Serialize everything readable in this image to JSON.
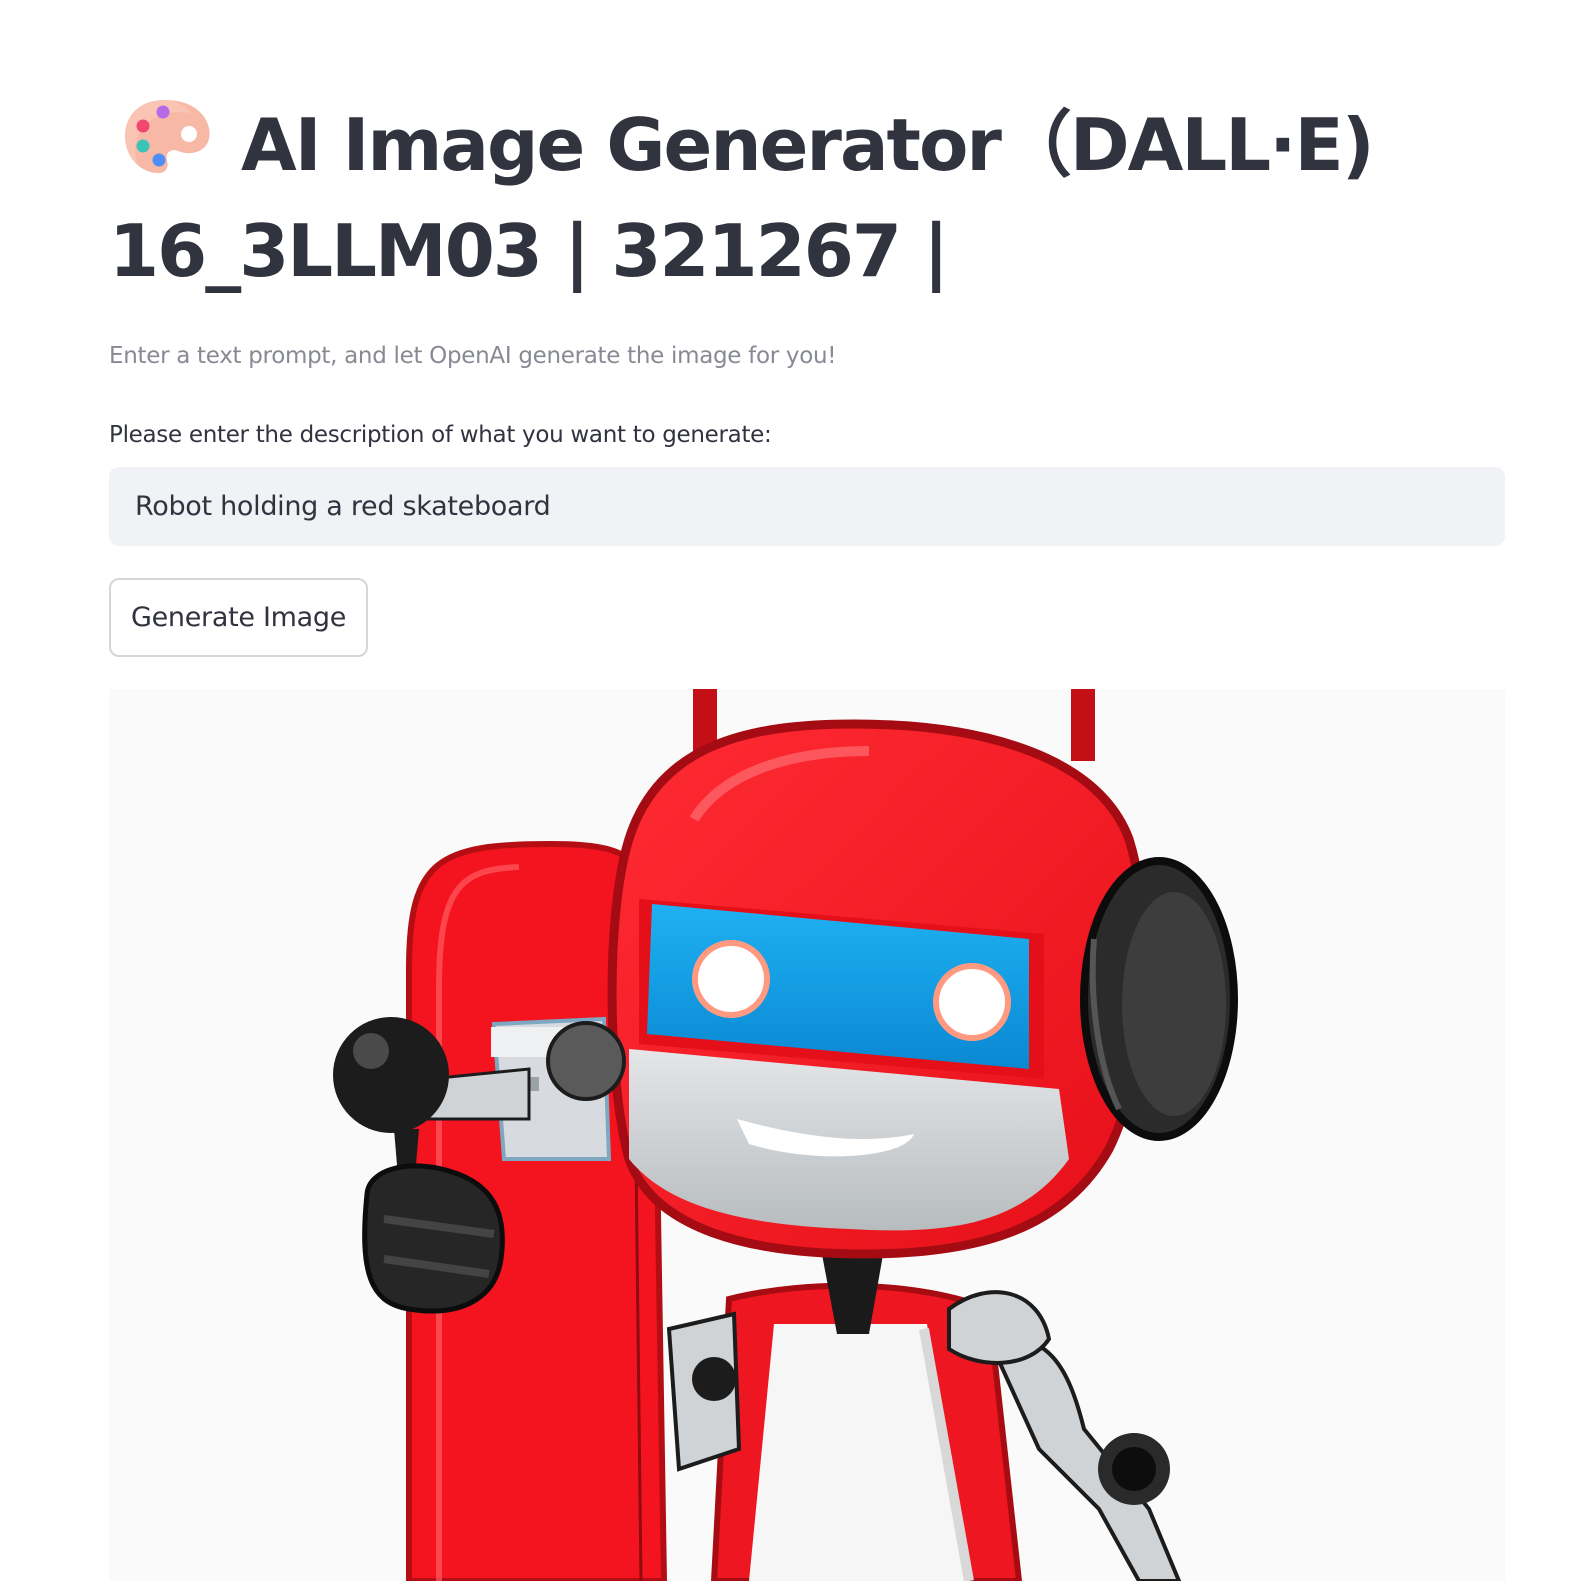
{
  "header": {
    "emoji_icon": "artist-palette-icon",
    "title": "AI Image Generator（DALL·E) 16_3LLM03 | 321267 |"
  },
  "caption": "Enter a text prompt, and let OpenAI generate the image for you!",
  "prompt_field": {
    "label": "Please enter the description of what you want to generate:",
    "value": "Robot holding a red skateboard"
  },
  "actions": {
    "generate_label": "Generate Image"
  },
  "result": {
    "image_subject": "red-robot-holding-red-skateboard-image"
  },
  "colors": {
    "text": "#31333f",
    "caption": "#878a93",
    "input_bg": "#f0f2f6",
    "button_border": "#d5d6da",
    "robot_red": "#f3141f"
  }
}
